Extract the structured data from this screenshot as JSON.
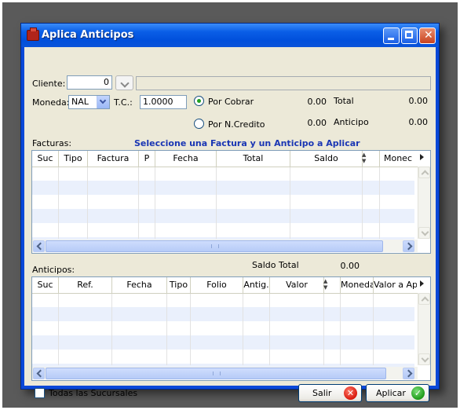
{
  "window": {
    "title": "Aplica Anticipos"
  },
  "cliente": {
    "label": "Cliente:",
    "value": "0",
    "name_value": ""
  },
  "moneda": {
    "label": "Moneda:",
    "value": "NAL"
  },
  "tc": {
    "label": "T.C.:",
    "value": "1.0000"
  },
  "options": {
    "por_cobrar": {
      "label": "Por Cobrar",
      "selected": true,
      "amount": "0.00"
    },
    "por_ncredito": {
      "label": "Por N.Credito",
      "selected": false,
      "amount": "0.00"
    }
  },
  "totals": {
    "total_label": "Total",
    "total_value": "0.00",
    "anticipo_label": "Anticipo",
    "anticipo_value": "0.00"
  },
  "facturas": {
    "label": "Facturas:",
    "instruction": "Seleccione una Factura y un Anticipo a Aplicar",
    "columns": [
      "Suc",
      "Tipo",
      "Factura",
      "P",
      "Fecha",
      "Total",
      "Saldo",
      "",
      "Monec"
    ]
  },
  "anticipos": {
    "label": "Anticipos:",
    "saldo_total_label": "Saldo Total",
    "saldo_total_value": "0.00",
    "columns": [
      "Suc",
      "Ref.",
      "Fecha",
      "Tipo",
      "Folio",
      "Antig.",
      "Valor",
      "",
      "Moneda",
      "Valor a Apl"
    ]
  },
  "todas_sucursales": {
    "label": "Todas las Sucursales",
    "checked": false
  },
  "buttons": {
    "salir": "Salir",
    "aplicar": "Aplicar"
  },
  "colors": {
    "titlebar": "#0a5ee6",
    "instruction": "#1a36b4",
    "row_alt": "#eaf0fc"
  }
}
